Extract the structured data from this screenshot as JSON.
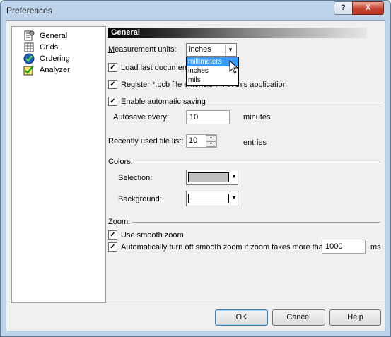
{
  "window": {
    "title": "Preferences",
    "help_button": "?",
    "close_button": "X"
  },
  "tree": {
    "items": [
      {
        "label": "General",
        "icon": "general-settings-icon"
      },
      {
        "label": "Grids",
        "icon": "grid-icon"
      },
      {
        "label": "Ordering",
        "icon": "ordering-icon"
      },
      {
        "label": "Analyzer",
        "icon": "analyzer-check-icon"
      }
    ]
  },
  "general": {
    "header": "General",
    "measurement_label": "Measurement units:",
    "measurement_value": "inches",
    "unit_options": [
      "millimeters",
      "inches",
      "mils"
    ],
    "highlighted_option": "millimeters",
    "load_last_label": "Load last document",
    "load_last_checked": true,
    "register_label": "Register *.pcb file extension with this application",
    "register_checked": true,
    "autosave_enable_label": "Enable automatic saving",
    "autosave_enable_checked": true,
    "autosave_every_label": "Autosave every:",
    "autosave_value": "10",
    "autosave_unit": "minutes",
    "recent_label": "Recently used file list:",
    "recent_value": "10",
    "recent_unit": "entries",
    "colors_label": "Colors:",
    "selection_label": "Selection:",
    "selection_color": "#c0c0c0",
    "background_label": "Background:",
    "background_color": "#ffffff",
    "zoom_label": "Zoom:",
    "smooth_zoom_label": "Use smooth zoom",
    "smooth_zoom_checked": true,
    "auto_off_label": "Automatically turn off smooth zoom if zoom takes more than",
    "auto_off_checked": true,
    "auto_off_value": "1000",
    "auto_off_unit": "ms"
  },
  "buttons": {
    "ok": "OK",
    "cancel": "Cancel",
    "help": "Help"
  }
}
